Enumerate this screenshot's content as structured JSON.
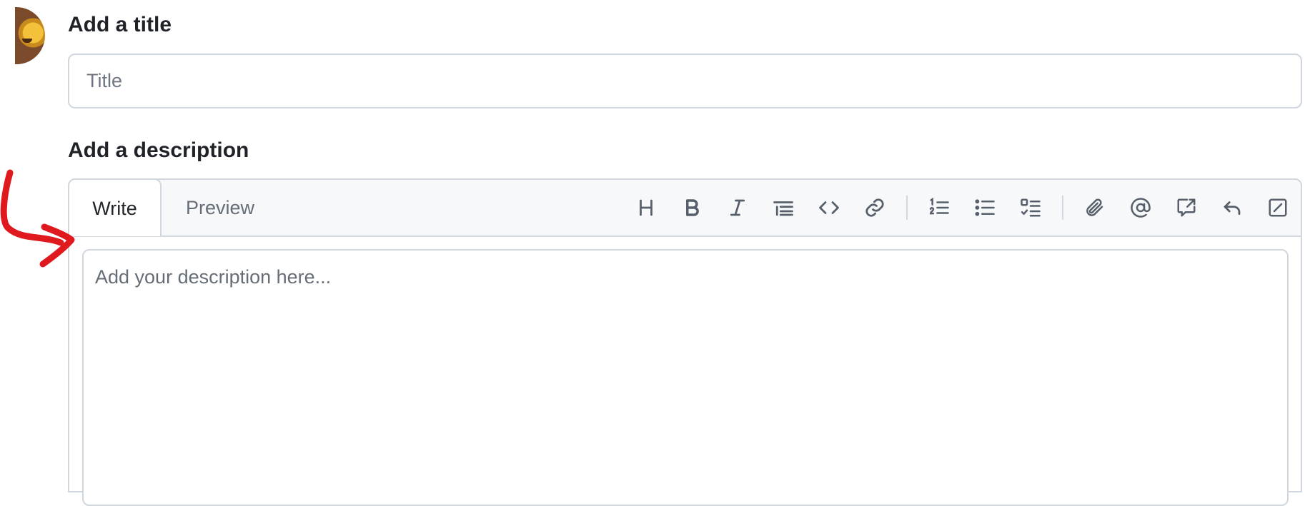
{
  "issue_form": {
    "title_label": "Add a title",
    "title_placeholder": "Title",
    "description_label": "Add a description",
    "description_placeholder": "Add your description here..."
  },
  "editor": {
    "tabs": [
      {
        "label": "Write",
        "active": true
      },
      {
        "label": "Preview",
        "active": false
      }
    ],
    "toolbar_icons": [
      "heading-icon",
      "bold-icon",
      "italic-icon",
      "quote-icon",
      "code-icon",
      "link-icon",
      "numbered-list-icon",
      "unordered-list-icon",
      "task-list-icon",
      "attach-file-icon",
      "mention-icon",
      "cross-reference-icon",
      "saved-reply-icon",
      "slash-commands-icon"
    ]
  },
  "annotation": {
    "type": "red hand-drawn arrow pointing to description textarea",
    "color": "#e0191f"
  },
  "colors": {
    "border": "#d0d7de",
    "header_bg": "#f6f8fa",
    "icon": "#57606a",
    "text": "#1f2328",
    "muted": "#656d76"
  }
}
